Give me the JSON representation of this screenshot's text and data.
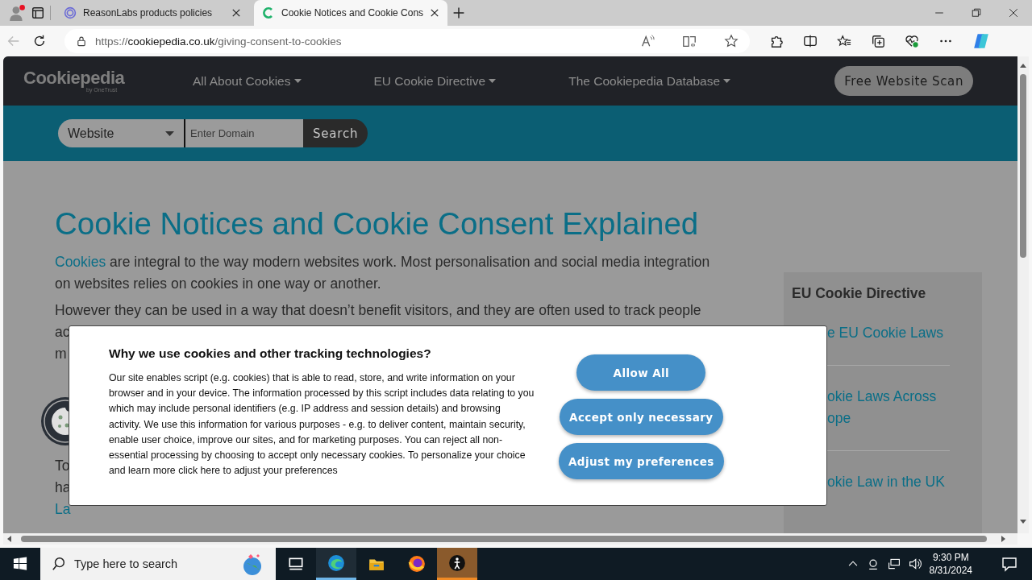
{
  "browser": {
    "tabs": [
      {
        "title": "ReasonLabs products policies",
        "selected": false
      },
      {
        "title": "Cookie Notices and Cookie Cons",
        "selected": true
      }
    ],
    "url": {
      "scheme": "https://",
      "host": "cookiepedia.co.uk",
      "path": "/giving-consent-to-cookies"
    }
  },
  "site": {
    "logo": "Cookiepedia",
    "logo_sub": "by OneTrust",
    "nav": [
      "All About Cookies",
      "EU Cookie Directive",
      "The Cookiepedia Database"
    ],
    "scan_button": "Free Website Scan",
    "search": {
      "select": "Website",
      "placeholder": "Enter Domain",
      "button": "Search"
    }
  },
  "article": {
    "title": "Cookie Notices and Cookie Consent Explained",
    "intro_link": "Cookies",
    "intro_text": " are integral to the way modern websites work. Most personalisation and social media integration on websites relies on cookies in one way or another.",
    "paragraphs": [
      {
        "lines": [
          {
            "text": "However they can be used in a way that doesn’t benefit visitors, and they are often used to track people",
            "link": false
          },
          {
            "text": "ac",
            "link": false
          },
          {
            "text": "m",
            "link": false
          }
        ]
      },
      {
        "lines": [
          {
            "text": "To",
            "link": false
          },
          {
            "text": "ha",
            "link": false
          },
          {
            "text": "La",
            "link": true
          }
        ]
      }
    ]
  },
  "sidebar": {
    "title": "EU Cookie Directive",
    "items": [
      {
        "lines": [
          "e EU Cookie Laws"
        ]
      },
      {
        "lines": [
          "okie Laws Across",
          "ope"
        ]
      },
      {
        "lines": [
          "okie Law in the UK"
        ]
      }
    ]
  },
  "consent": {
    "title": "Why we use cookies and other tracking technologies?",
    "body": "Our site enables script (e.g. cookies) that is able to read, store, and write information on your browser and in your device. The information processed by this script includes data relating to you which may include personal identifiers (e.g. IP address and session details) and browsing activity. We use this information for various purposes - e.g. to deliver content, maintain security, enable user choice, improve our sites, and for marketing purposes. You can reject all non-essential processing by choosing to accept only necessary cookies. To personalize your choice and learn more click here to adjust your preferences",
    "buttons": [
      "Allow All",
      "Accept only necessary",
      "Adjust my preferences"
    ]
  },
  "taskbar": {
    "search_placeholder": "Type here to search",
    "apps": [
      {
        "kind": "taskview",
        "selected": false
      },
      {
        "kind": "edge",
        "selected": true
      },
      {
        "kind": "explorer",
        "selected": false
      },
      {
        "kind": "firefox",
        "selected": false
      },
      {
        "kind": "figure",
        "selected": true
      }
    ],
    "time": "9:30 PM",
    "date": "8/31/2024"
  }
}
